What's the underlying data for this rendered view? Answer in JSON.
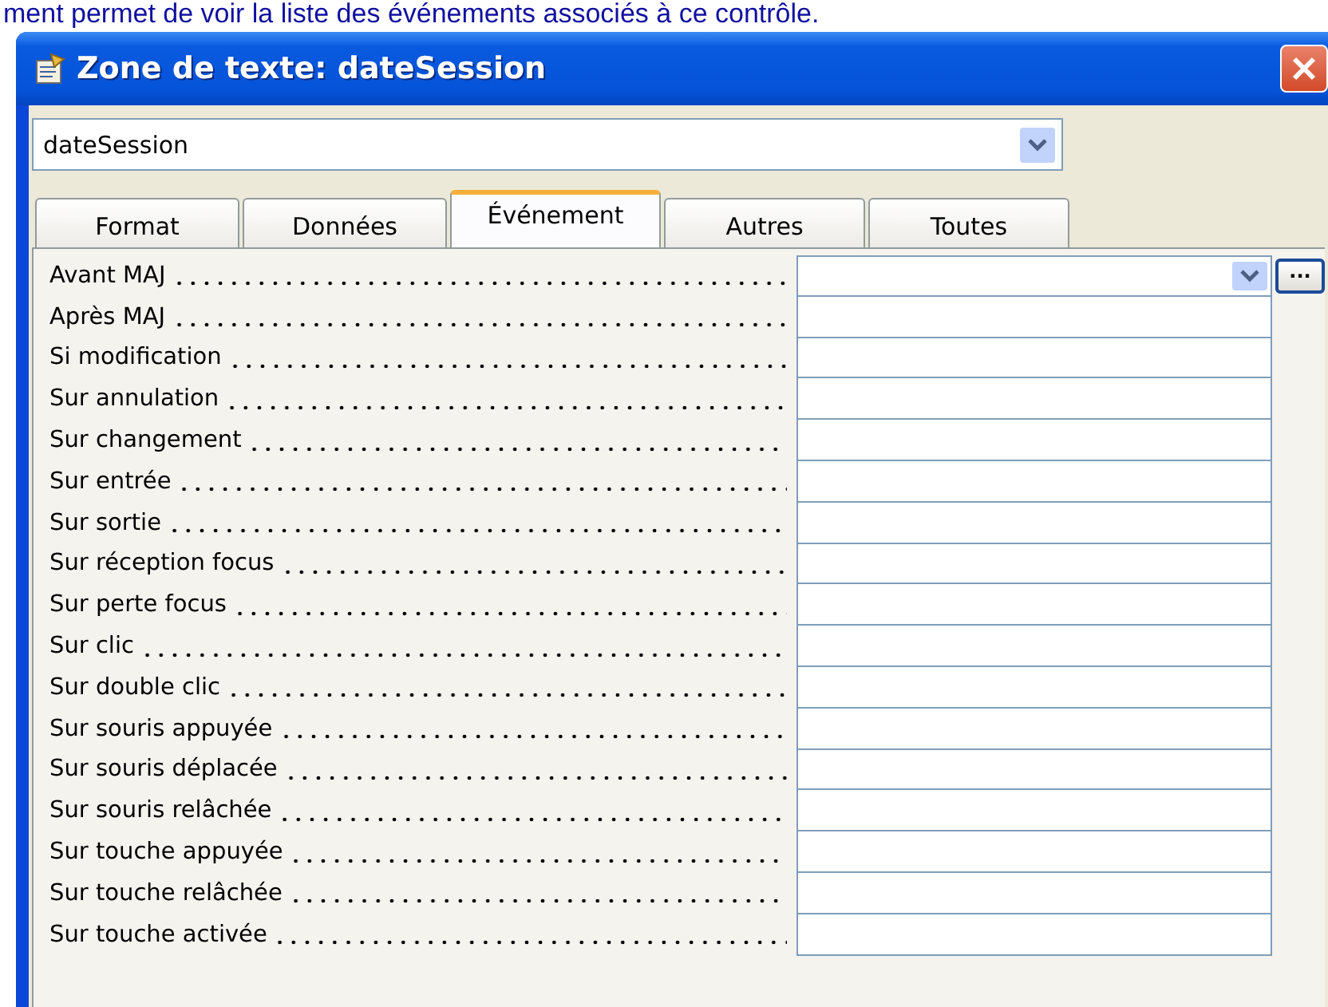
{
  "caption": "ment permet de voir la liste des événements associés à ce contrôle.",
  "window": {
    "title": "Zone de texte: dateSession"
  },
  "object_selector": {
    "value": "dateSession"
  },
  "tabs": [
    {
      "label": "Format",
      "selected": false
    },
    {
      "label": "Données",
      "selected": false
    },
    {
      "label": "Événement",
      "selected": true
    },
    {
      "label": "Autres",
      "selected": false
    },
    {
      "label": "Toutes",
      "selected": false
    }
  ],
  "properties": [
    {
      "label": "Avant MAJ",
      "selected": true
    },
    {
      "label": "Après MAJ",
      "selected": false
    },
    {
      "label": "Si modification",
      "selected": false
    },
    {
      "label": "Sur annulation",
      "selected": false
    },
    {
      "label": "Sur changement",
      "selected": false
    },
    {
      "label": "Sur entrée",
      "selected": false
    },
    {
      "label": "Sur sortie",
      "selected": false
    },
    {
      "label": "Sur réception focus",
      "selected": false
    },
    {
      "label": "Sur perte focus",
      "selected": false
    },
    {
      "label": "Sur clic",
      "selected": false
    },
    {
      "label": "Sur double clic",
      "selected": false
    },
    {
      "label": "Sur souris appuyée",
      "selected": false
    },
    {
      "label": "Sur souris déplacée",
      "selected": false
    },
    {
      "label": "Sur souris relâchée",
      "selected": false
    },
    {
      "label": "Sur touche appuyée",
      "selected": false
    },
    {
      "label": "Sur touche relâchée",
      "selected": false
    },
    {
      "label": "Sur touche activée",
      "selected": false
    }
  ],
  "builder_button": {
    "label": "..."
  }
}
